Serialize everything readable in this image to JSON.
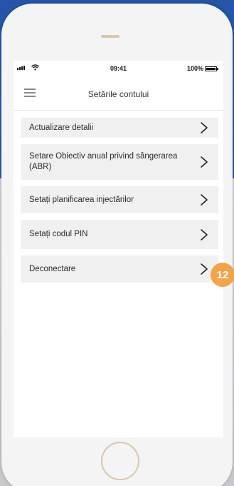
{
  "status_bar": {
    "time": "09:41",
    "battery_percent": "100%",
    "wifi_icon": "wifi-icon",
    "signal_icon": "signal-bars-icon"
  },
  "header": {
    "title": "Setările contului",
    "menu_icon": "hamburger-menu-icon"
  },
  "menu": {
    "items": [
      {
        "label": "Actualizare detalii",
        "icon": "chevron-right-icon"
      },
      {
        "label": "Setare Obiectiv anual privind sângerarea (ABR)",
        "icon": "chevron-right-icon"
      },
      {
        "label": "Setați planificarea injectărilor",
        "icon": "chevron-right-icon"
      },
      {
        "label": "Setați codul PIN",
        "icon": "chevron-right-icon"
      },
      {
        "label": "Deconectare",
        "icon": "chevron-right-icon"
      }
    ]
  },
  "callout": {
    "number": "12"
  },
  "colors": {
    "background_top": "#2a5bb0",
    "accent_gold": "#d7c7ad",
    "badge_orange": "#f2a548",
    "item_background": "#f0f0f0"
  }
}
